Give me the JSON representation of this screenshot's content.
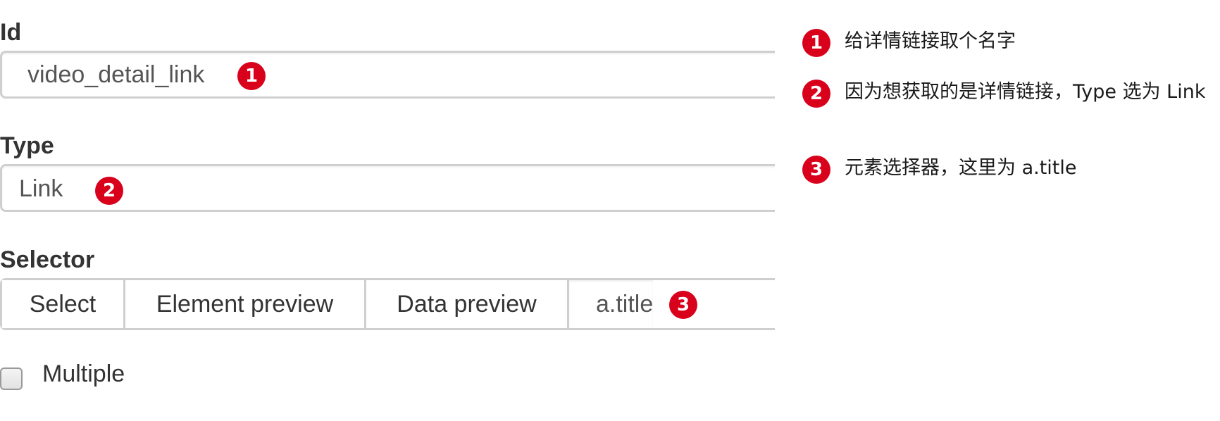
{
  "form": {
    "id_field": {
      "label": "Id",
      "value": "video_detail_link",
      "badge": "1"
    },
    "type_field": {
      "label": "Type",
      "value": "Link",
      "badge": "2"
    },
    "selector_field": {
      "label": "Selector",
      "buttons": [
        "Select",
        "Element preview",
        "Data preview"
      ],
      "value": "a.title",
      "badge": "3"
    },
    "multiple": {
      "label": "Multiple",
      "checked": false
    }
  },
  "notes": [
    {
      "number": "1",
      "text": "给详情链接取个名字"
    },
    {
      "number": "2",
      "text": "因为想获取的是详情链接，Type 选为 Link"
    },
    {
      "number": "3",
      "text": "元素选择器，这里为 a.title"
    }
  ],
  "colors": {
    "badge": "#d9001b",
    "border": "#cfcfcf",
    "label_text": "#333333"
  }
}
